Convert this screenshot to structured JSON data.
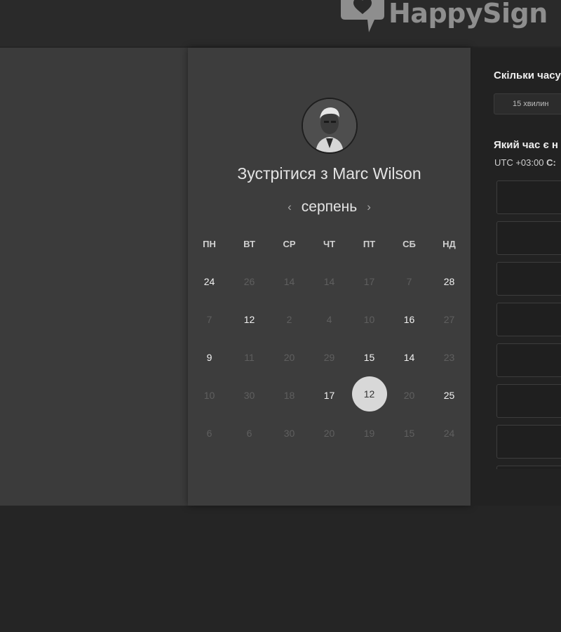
{
  "header": {
    "brand": "HappySign"
  },
  "profile": {
    "title_prefix": "Зустрітися з",
    "name": "Marc Wilson"
  },
  "calendar": {
    "month": "серпень",
    "weekdays": [
      "ПН",
      "ВТ",
      "СР",
      "ЧТ",
      "ПТ",
      "СБ",
      "НД"
    ],
    "weeks": [
      [
        {
          "d": "24",
          "a": true
        },
        {
          "d": "26",
          "a": false
        },
        {
          "d": "14",
          "a": false
        },
        {
          "d": "14",
          "a": false
        },
        {
          "d": "17",
          "a": false
        },
        {
          "d": "7",
          "a": false
        },
        {
          "d": "28",
          "a": true
        }
      ],
      [
        {
          "d": "7",
          "a": false
        },
        {
          "d": "12",
          "a": true
        },
        {
          "d": "2",
          "a": false
        },
        {
          "d": "4",
          "a": false
        },
        {
          "d": "10",
          "a": false
        },
        {
          "d": "16",
          "a": true
        },
        {
          "d": "27",
          "a": false
        }
      ],
      [
        {
          "d": "9",
          "a": true
        },
        {
          "d": "11",
          "a": false
        },
        {
          "d": "20",
          "a": false
        },
        {
          "d": "29",
          "a": false
        },
        {
          "d": "15",
          "a": true
        },
        {
          "d": "14",
          "a": true
        },
        {
          "d": "23",
          "a": false
        }
      ],
      [
        {
          "d": "10",
          "a": false
        },
        {
          "d": "30",
          "a": false
        },
        {
          "d": "18",
          "a": false
        },
        {
          "d": "17",
          "a": true
        },
        {
          "d": "12",
          "a": true,
          "selected": true
        },
        {
          "d": "20",
          "a": false
        },
        {
          "d": "25",
          "a": true
        }
      ],
      [
        {
          "d": "6",
          "a": false
        },
        {
          "d": "6",
          "a": false
        },
        {
          "d": "30",
          "a": false
        },
        {
          "d": "20",
          "a": false
        },
        {
          "d": "19",
          "a": false
        },
        {
          "d": "15",
          "a": false
        },
        {
          "d": "24",
          "a": false
        }
      ]
    ]
  },
  "booking": {
    "duration_heading": "Скільки часу",
    "duration_value": "15 хвилин",
    "time_heading": "Який час є н",
    "timezone_prefix": "UTC +03:00",
    "timezone_suffix": "С:"
  },
  "colors": {
    "background": "#252525",
    "card": "#3d3d3d",
    "panel": "#222222",
    "selected_day": "#d8d8d8"
  },
  "icons": {
    "prev": "chevron-left-icon",
    "next": "chevron-right-icon",
    "logo": "speech-heart-icon"
  }
}
